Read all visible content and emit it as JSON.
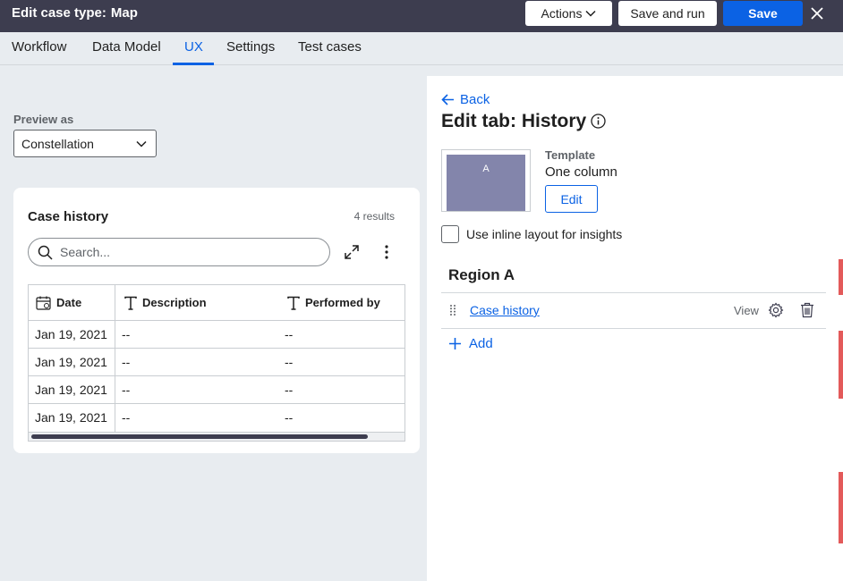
{
  "header": {
    "title_prefix": "Edit case type:",
    "title_name": "Map",
    "actions_label": "Actions",
    "save_run_label": "Save and run",
    "save_label": "Save"
  },
  "tabs": [
    {
      "label": "Workflow"
    },
    {
      "label": "Data Model"
    },
    {
      "label": "UX",
      "active": true
    },
    {
      "label": "Settings"
    },
    {
      "label": "Test cases"
    }
  ],
  "preview": {
    "label": "Preview as",
    "selected": "Constellation"
  },
  "case_history": {
    "title": "Case history",
    "count": "4 results",
    "search_placeholder": "Search...",
    "columns": [
      "Date",
      "Description",
      "Performed by"
    ],
    "rows": [
      [
        "Jan 19, 2021",
        "--",
        "--"
      ],
      [
        "Jan 19, 2021",
        "--",
        "--"
      ],
      [
        "Jan 19, 2021",
        "--",
        "--"
      ],
      [
        "Jan 19, 2021",
        "--",
        "--"
      ]
    ]
  },
  "edit_tab": {
    "back_label": "Back",
    "title": "Edit tab: History",
    "template_label": "Template",
    "template_value": "One column",
    "thumb_letter": "A",
    "edit_button": "Edit",
    "inline_layout_label": "Use inline layout for insights",
    "inline_layout_checked": false,
    "region_title": "Region A",
    "view_name": "Case history",
    "view_tag": "View",
    "add_label": "Add"
  },
  "colors": {
    "header_bg": "#3d3d4f",
    "accent": "#0b62e4",
    "template_thumb": "#8385ab"
  }
}
